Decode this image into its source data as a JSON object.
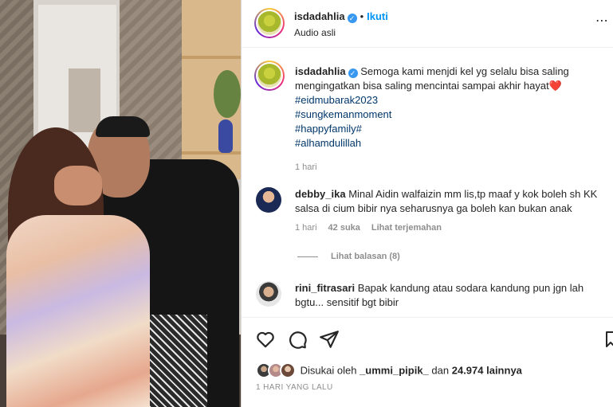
{
  "post_header": {
    "username": "isdadahlia",
    "separator": "•",
    "follow_label": "Ikuti",
    "audio_label": "Audio asli"
  },
  "caption": {
    "username": "isdadahlia",
    "text": "Semoga kami menjdi kel yg selalu bisa saling mengingatkan bisa saling mencintai sampai akhir hayat",
    "emoji": "❤️",
    "hashtags": [
      "#eidmubarak2023",
      "#sungkemanmoment",
      "#happyfamily#",
      "#alhamdulillah"
    ],
    "time": "1 hari"
  },
  "comments": [
    {
      "username": "debby_ika",
      "text": "Minal Aidin walfaizin mm lis,tp maaf y kok boleh sh KK salsa di cium bibir nya seharusnya ga boleh kan bukan anak",
      "time": "1 hari",
      "likes": "42 suka",
      "translate": "Lihat terjemahan",
      "replies": "Lihat balasan (8)"
    },
    {
      "username": "rini_fitrasari",
      "text": "Bapak kandung atau sodara kandung pun jgn lah bgtu... sensitif bgt bibir"
    }
  ],
  "likes": {
    "prefix": "Disukai oleh",
    "user": "_ummi_pipik_",
    "middle": "dan",
    "count": "24.974 lainnya"
  },
  "date": "1 HARI YANG LALU",
  "icons": [
    "heart-icon",
    "comment-icon",
    "share-icon",
    "bookmark-icon",
    "verified-badge-icon",
    "more-options-icon"
  ],
  "colors": {
    "link": "#0095f6",
    "hashtag": "#00376b",
    "muted": "#8e8e8e",
    "heart": "#ed4956",
    "verified": "#3897f0"
  }
}
